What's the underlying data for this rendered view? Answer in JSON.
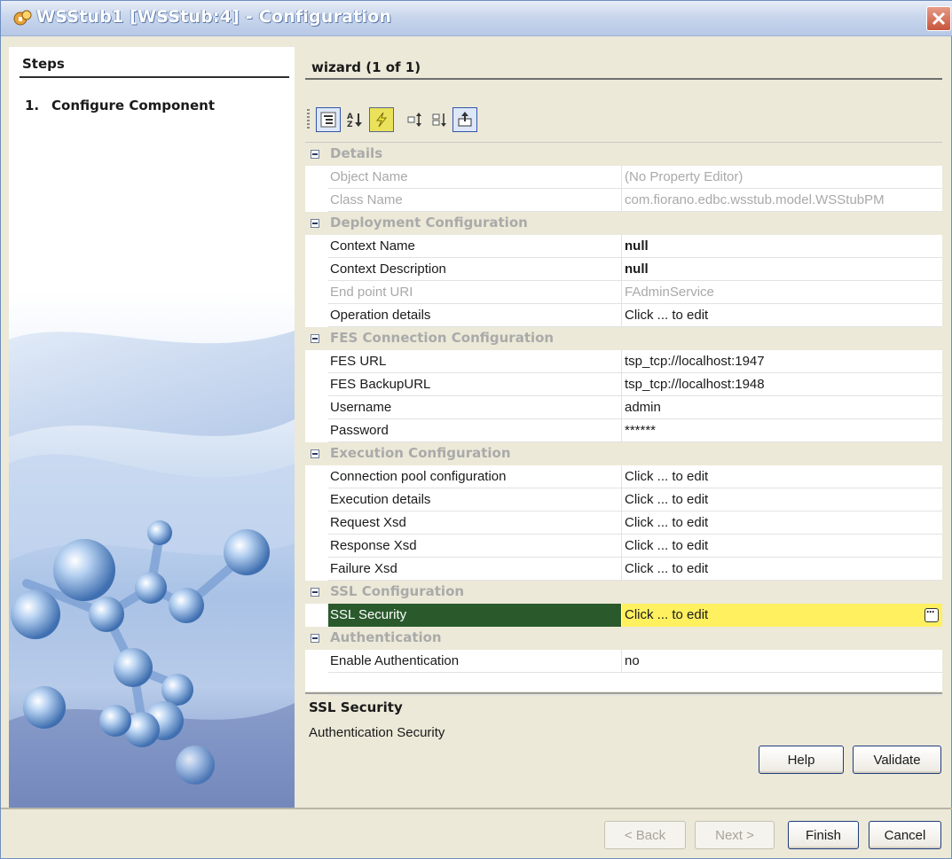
{
  "window": {
    "title": "WSStub1 [WSStub:4] - Configuration"
  },
  "steps": {
    "header": "Steps",
    "items": [
      {
        "num": "1.",
        "label": "Configure Component"
      }
    ]
  },
  "wizard": {
    "title": "wizard (1 of 1)"
  },
  "toolbar": {
    "buttons": [
      "categorized-view-icon",
      "alphabetical-sort-icon",
      "lightning-icon",
      "expand-icon",
      "collapse-icon",
      "export-icon"
    ]
  },
  "properties": {
    "categories": [
      {
        "label": "Details",
        "rows": [
          {
            "name": "Object Name",
            "value": "(No Property Editor)",
            "disabled": true
          },
          {
            "name": "Class Name",
            "value": "com.fiorano.edbc.wsstub.model.WSStubPM",
            "disabled": true
          }
        ]
      },
      {
        "label": "Deployment Configuration",
        "rows": [
          {
            "name": "Context Name",
            "value": "null",
            "bold": true
          },
          {
            "name": "Context Description",
            "value": "null",
            "bold": true
          },
          {
            "name": "End point URI",
            "value": "FAdminService",
            "disabled": true
          },
          {
            "name": "Operation details",
            "value": "Click ... to edit"
          }
        ]
      },
      {
        "label": "FES Connection Configuration",
        "rows": [
          {
            "name": "FES URL",
            "value": "tsp_tcp://localhost:1947"
          },
          {
            "name": "FES BackupURL",
            "value": "tsp_tcp://localhost:1948"
          },
          {
            "name": "Username",
            "value": "admin"
          },
          {
            "name": "Password",
            "value": "******"
          }
        ]
      },
      {
        "label": "Execution Configuration",
        "rows": [
          {
            "name": "Connection pool configuration",
            "value": "Click ... to edit"
          },
          {
            "name": "Execution details",
            "value": "Click ... to edit"
          },
          {
            "name": "Request Xsd",
            "value": "Click ... to edit"
          },
          {
            "name": "Response Xsd",
            "value": "Click ... to edit"
          },
          {
            "name": "Failure Xsd",
            "value": "Click ... to edit"
          }
        ]
      },
      {
        "label": "SSL Configuration",
        "rows": [
          {
            "name": "SSL Security",
            "value": "Click ... to edit",
            "selected": true
          }
        ]
      },
      {
        "label": "Authentication",
        "rows": [
          {
            "name": "Enable Authentication",
            "value": "no"
          }
        ]
      }
    ]
  },
  "description": {
    "title": "SSL Security",
    "text": "Authentication Security"
  },
  "buttons": {
    "help": "Help",
    "validate": "Validate",
    "back": "< Back",
    "next": "Next >",
    "finish": "Finish",
    "cancel": "Cancel"
  },
  "colors": {
    "selected_name_bg": "#2a5a2c",
    "selected_value_bg": "#fff060",
    "category_label": "#aaaaaa"
  }
}
